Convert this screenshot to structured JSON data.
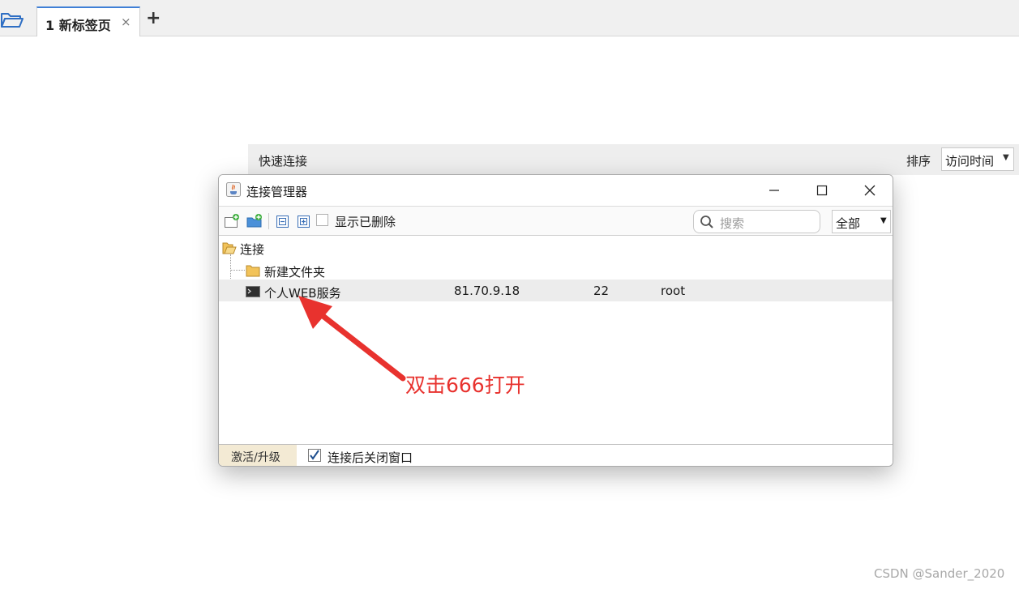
{
  "tabbar": {
    "tab_label": "1 新标签页",
    "tab_close": "×",
    "add_tab": "+"
  },
  "quick_connect": {
    "title": "快速连接",
    "sort_label": "排序",
    "sort_value": "访问时间"
  },
  "dialog": {
    "title": "连接管理器",
    "toolbar": {
      "show_deleted_label": "显示已删除",
      "show_deleted_checked": false,
      "search_placeholder": "搜索",
      "filter_value": "全部"
    },
    "tree": {
      "root_label": "连接",
      "folder_label": "新建文件夹",
      "session": {
        "name": "个人WEB服务",
        "host": "81.70.9.18",
        "port": "22",
        "user": "root"
      }
    },
    "status": {
      "activate_label": "激活/升级",
      "close_after_label": "连接后关闭窗口",
      "close_after_checked": true
    }
  },
  "annotation": {
    "text": "双击666打开",
    "color": "#e8322e"
  },
  "watermark": "CSDN @Sander_2020",
  "colors": {
    "accent": "#3f7fd6",
    "folder": "#f2c35a"
  }
}
